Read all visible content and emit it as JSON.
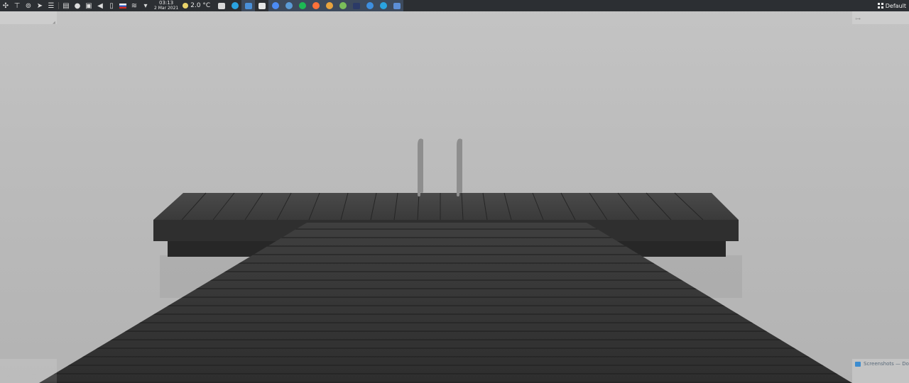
{
  "panel": {
    "clock": {
      "time": "03:13",
      "date": "2 Mar 2021"
    },
    "weather": {
      "temperature": "2.0 °C",
      "icon": "sun-icon"
    },
    "tray_icons": [
      "app-launcher-icon",
      "network-icon",
      "vpn-icon",
      "telegram-send-icon",
      "window-list-icon",
      "clipboard-icon",
      "bulb-icon",
      "drive-icon",
      "volume-icon",
      "battery-icon",
      "keyboard-layout-flag-icon",
      "wifi-icon",
      "tray-expand-icon"
    ],
    "tasks": [
      {
        "name": "file-manager-icon",
        "color": "#d9d9d9"
      },
      {
        "name": "telegram-icon",
        "color": "#2aa3e0"
      },
      {
        "name": "window-icon",
        "color": "#4a90d9"
      },
      {
        "name": "vk-icon",
        "color": "#e6e6e6"
      },
      {
        "name": "chrome-icon",
        "color": "#4c8bf5"
      },
      {
        "name": "chromium-icon",
        "color": "#5b9bd5"
      },
      {
        "name": "spotify-icon",
        "color": "#1db954"
      },
      {
        "name": "firefox-icon",
        "color": "#ff7139"
      },
      {
        "name": "color-picker-icon",
        "color": "#e8a33d"
      },
      {
        "name": "tor-icon",
        "color": "#7bbf5a"
      },
      {
        "name": "terminal-icon",
        "color": "#2b3a67"
      },
      {
        "name": "browser-icon",
        "color": "#3d8fe0"
      },
      {
        "name": "telegram-2-icon",
        "color": "#2aa3e0"
      },
      {
        "name": "chat-icon",
        "color": "#5c8fd8"
      }
    ],
    "active_layout": "Default"
  },
  "notification": {
    "title": "Screenshots — Dolphin"
  },
  "colors": {
    "panel": "#2c2f33",
    "fog": "#b9b9b9",
    "deck": "#3a3a3a"
  }
}
